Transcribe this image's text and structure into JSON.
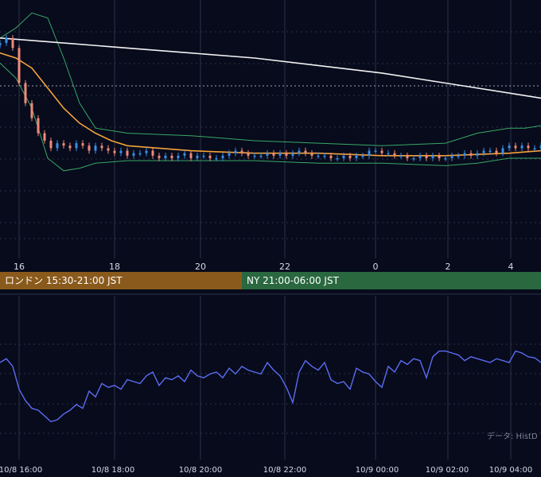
{
  "colors": {
    "background": "#070b1c",
    "grid": "#2c3047",
    "candle_up": "#3a8ee6",
    "candle_down": "#f08a7a",
    "ma_long": "#f2f2f2",
    "ma_short": "#f5a23a",
    "bollinger": "#3aa865",
    "rsi_line": "#5b6cf0",
    "london_session": "#8a5a1c",
    "ny_session": "#2a6840"
  },
  "sessions": {
    "london": "ロンドン 15:30-21:00 JST",
    "ny": "NY 21:00-06:00 JST"
  },
  "source_note": "データ: HistData",
  "chart_data": [
    {
      "type": "candlestick",
      "x_tick_labels": [
        "16",
        "18",
        "20",
        "22",
        "0",
        "2",
        "4"
      ],
      "y_range": [
        0,
        100
      ],
      "grid": true,
      "series": [
        {
          "kind": "close",
          "x": [
            0,
            2,
            4,
            6,
            8,
            10,
            12,
            14,
            16,
            18,
            20,
            22,
            24,
            26,
            28,
            30,
            32,
            34,
            36,
            38,
            40,
            42,
            44,
            46,
            48,
            50,
            52,
            54,
            56,
            58,
            60,
            62,
            64,
            66,
            68,
            70,
            72,
            74,
            76,
            78,
            80,
            82,
            84,
            86,
            88,
            90,
            92,
            94,
            96,
            98,
            100,
            102,
            104,
            106,
            108,
            110,
            112,
            114,
            116,
            118,
            120,
            122,
            124,
            126,
            128,
            130,
            132,
            134,
            136,
            138,
            140,
            142,
            144,
            146,
            148,
            150,
            152,
            154,
            156,
            158,
            160,
            162,
            164,
            166,
            168,
            170
          ],
          "values": [
            86,
            88,
            84,
            70,
            62,
            56,
            50,
            47,
            44,
            46,
            45,
            44,
            46,
            45,
            43,
            45,
            44,
            43,
            42,
            43,
            41,
            42,
            42,
            43,
            41,
            40,
            41,
            40,
            41,
            42,
            40,
            41,
            41,
            40,
            40,
            41,
            42,
            43,
            42,
            41,
            41,
            41,
            42,
            41,
            42,
            41,
            42,
            43,
            42,
            41,
            41,
            41,
            40,
            40,
            41,
            40,
            41,
            41,
            43,
            43,
            42,
            42,
            41,
            41,
            40,
            40,
            41,
            40,
            41,
            40,
            40,
            41,
            41,
            42,
            41,
            42,
            43,
            43,
            42,
            44,
            45,
            44,
            45,
            44,
            44,
            45
          ]
        },
        {
          "kind": "ma_long",
          "x": [
            0,
            20,
            40,
            60,
            80,
            100,
            120,
            140,
            160,
            170
          ],
          "values": [
            88,
            86,
            84,
            82,
            80,
            77,
            74,
            70,
            66,
            64
          ]
        },
        {
          "kind": "ma_short",
          "x": [
            0,
            5,
            10,
            15,
            20,
            25,
            30,
            35,
            40,
            50,
            60,
            80,
            100,
            120,
            140,
            160,
            170
          ],
          "values": [
            82,
            80,
            76,
            68,
            60,
            54,
            50,
            47,
            45,
            44,
            43,
            42,
            42,
            41,
            41,
            42,
            43
          ]
        },
        {
          "kind": "bollinger_upper",
          "x": [
            0,
            5,
            10,
            15,
            20,
            25,
            30,
            40,
            60,
            80,
            100,
            120,
            140,
            150,
            160,
            165,
            170
          ],
          "values": [
            88,
            92,
            98,
            96,
            80,
            62,
            52,
            50,
            49,
            47,
            46,
            45,
            46,
            50,
            52,
            52,
            53
          ]
        },
        {
          "kind": "bollinger_lower",
          "x": [
            0,
            5,
            10,
            15,
            20,
            25,
            30,
            40,
            60,
            80,
            100,
            120,
            140,
            150,
            160,
            165,
            170
          ],
          "values": [
            78,
            72,
            60,
            40,
            35,
            36,
            38,
            39,
            39,
            39,
            38,
            38,
            37,
            38,
            40,
            40,
            40
          ]
        }
      ]
    },
    {
      "type": "line",
      "name": "rsi",
      "x_tick_labels": [
        "10/8 16:00",
        "10/8 18:00",
        "10/8 20:00",
        "10/8 22:00",
        "10/9 00:00",
        "10/9 02:00",
        "10/9 04:00"
      ],
      "y_range": [
        0,
        100
      ],
      "grid": true,
      "x": [
        0,
        2,
        4,
        6,
        8,
        10,
        12,
        14,
        16,
        18,
        20,
        22,
        24,
        26,
        28,
        30,
        32,
        34,
        36,
        38,
        40,
        42,
        44,
        46,
        48,
        50,
        52,
        54,
        56,
        58,
        60,
        62,
        64,
        66,
        68,
        70,
        72,
        74,
        76,
        78,
        80,
        82,
        84,
        86,
        88,
        90,
        92,
        94,
        96,
        98,
        100,
        102,
        104,
        106,
        108,
        110,
        112,
        114,
        116,
        118,
        120,
        122,
        124,
        126,
        128,
        130,
        132,
        134,
        136,
        138,
        140,
        142,
        144,
        146,
        148,
        150,
        152,
        154,
        156,
        158,
        160,
        162,
        164,
        166,
        168,
        170
      ],
      "values": [
        70,
        74,
        66,
        42,
        30,
        22,
        20,
        14,
        8,
        10,
        16,
        20,
        26,
        22,
        40,
        34,
        48,
        44,
        46,
        42,
        52,
        50,
        48,
        56,
        60,
        46,
        54,
        52,
        56,
        50,
        62,
        56,
        54,
        58,
        60,
        54,
        64,
        58,
        66,
        62,
        60,
        58,
        70,
        62,
        56,
        44,
        28,
        60,
        72,
        66,
        62,
        70,
        52,
        48,
        50,
        42,
        64,
        60,
        58,
        50,
        44,
        66,
        60,
        72,
        68,
        74,
        72,
        54,
        76,
        82,
        82,
        80,
        78,
        72,
        76,
        74,
        72,
        70,
        74,
        72,
        70,
        82,
        80,
        76,
        75,
        70
      ]
    }
  ]
}
